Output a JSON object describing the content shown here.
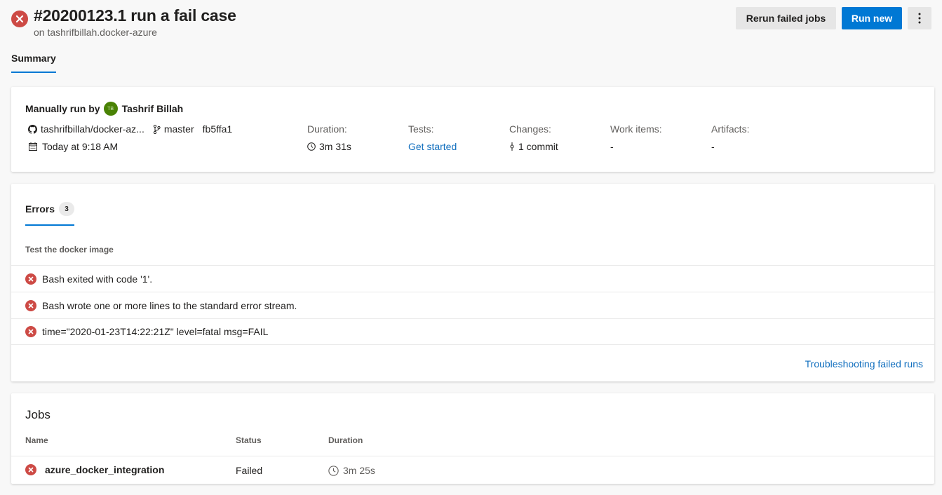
{
  "header": {
    "title": "#20200123.1 run a fail case",
    "subtitle": "on tashrifbillah.docker-azure",
    "rerun_label": "Rerun failed jobs",
    "run_new_label": "Run new",
    "more_label": "⋮",
    "status_icon": "error-circle-icon"
  },
  "tabs": {
    "summary": "Summary"
  },
  "summary": {
    "run_by_prefix": "Manually run by",
    "avatar_initials": "TB",
    "user": "Tashrif Billah",
    "repo": "tashrifbillah/docker-az...",
    "branch": "master",
    "commit": "fb5ffa1",
    "time": "Today at 9:18 AM",
    "duration_label": "Duration:",
    "duration_value": "3m 31s",
    "tests_label": "Tests:",
    "tests_value": "Get started",
    "changes_label": "Changes:",
    "changes_value": "1 commit",
    "workitems_label": "Work items:",
    "workitems_value": "-",
    "artifacts_label": "Artifacts:",
    "artifacts_value": "-"
  },
  "errors": {
    "tab_label": "Errors",
    "count": "3",
    "section": "Test the docker image",
    "items": [
      "Bash exited with code '1'.",
      "Bash wrote one or more lines to the standard error stream.",
      "time=\"2020-01-23T14:22:21Z\" level=fatal msg=FAIL"
    ],
    "troubleshoot_link": "Troubleshooting failed runs"
  },
  "jobs": {
    "title": "Jobs",
    "col_name": "Name",
    "col_status": "Status",
    "col_duration": "Duration",
    "rows": [
      {
        "name": "azure_docker_integration",
        "status": "Failed",
        "duration": "3m 25s"
      }
    ]
  },
  "colors": {
    "accent": "#0078d4",
    "error": "#cd4a45",
    "link": "#106ebe",
    "avatar": "#498205"
  }
}
